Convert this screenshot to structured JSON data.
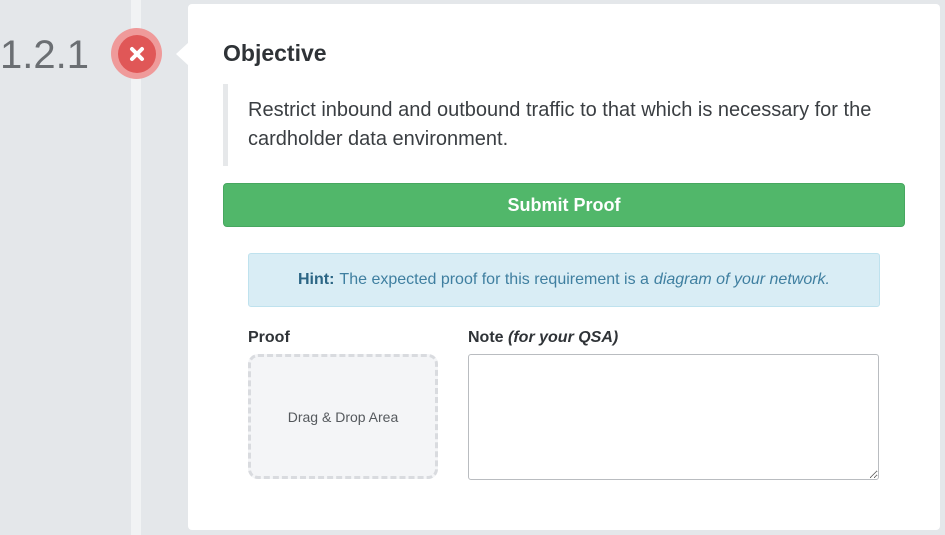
{
  "requirement": {
    "number": "1.2.1",
    "status_icon": "close-icon",
    "status_color": "#e05757"
  },
  "objective": {
    "heading": "Objective",
    "text": "Restrict inbound and outbound traffic to that which is necessary for the cardholder data environment."
  },
  "submit": {
    "label": "Submit Proof",
    "color": "#51b76a"
  },
  "hint": {
    "label": "Hint:",
    "text": "The expected proof for this requirement is a",
    "emphasis": "diagram of your network."
  },
  "proof": {
    "label": "Proof",
    "drop_text": "Drag & Drop Area"
  },
  "note": {
    "label": "Note",
    "label_suffix": "(for your QSA)",
    "value": ""
  }
}
